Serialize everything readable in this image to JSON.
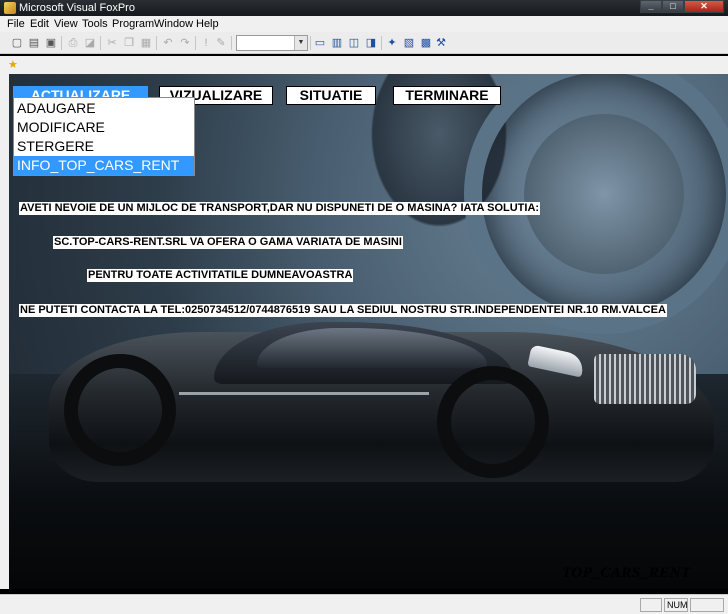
{
  "window": {
    "title": "Microsoft Visual FoxPro",
    "buttons": [
      "_",
      "□",
      "✕"
    ]
  },
  "menubar": {
    "items": [
      "File",
      "Edit",
      "View",
      "Tools",
      "Program",
      "Window",
      "Help"
    ]
  },
  "toolbar": {
    "combo_value": ""
  },
  "form_menu": {
    "buttons": [
      "ACTUALIZARE",
      "VIZUALIZARE",
      "SITUATIE",
      "TERMINARE"
    ],
    "active": "ACTUALIZARE",
    "dropdown": [
      "ADAUGARE",
      "MODIFICARE",
      "STERGERE",
      "INFO_TOP_CARS_RENT"
    ],
    "dropdown_highlighted": "INFO_TOP_CARS_RENT"
  },
  "info_text": [
    "AVETI NEVOIE DE UN MIJLOC DE TRANSPORT,DAR NU DISPUNETI DE O MASINA? IATA SOLUTIA:",
    "SC.TOP-CARS-RENT.SRL VA OFERA O GAMA VARIATA DE MASINI",
    "PENTRU TOATE ACTIVITATILE DUMNEAVOASTRA",
    "NE PUTETI CONTACTA LA TEL:0250734512/0744876519 SAU LA SEDIUL NOSTRU STR.INDEPENDENTEI NR.10 RM.VALCEA"
  ],
  "brand_text": "TOP_CARS_RENT",
  "statusbar": {
    "num": "NUM"
  },
  "colors": {
    "highlight": "#3399ff",
    "menu_bg": "#f0f0f0"
  }
}
